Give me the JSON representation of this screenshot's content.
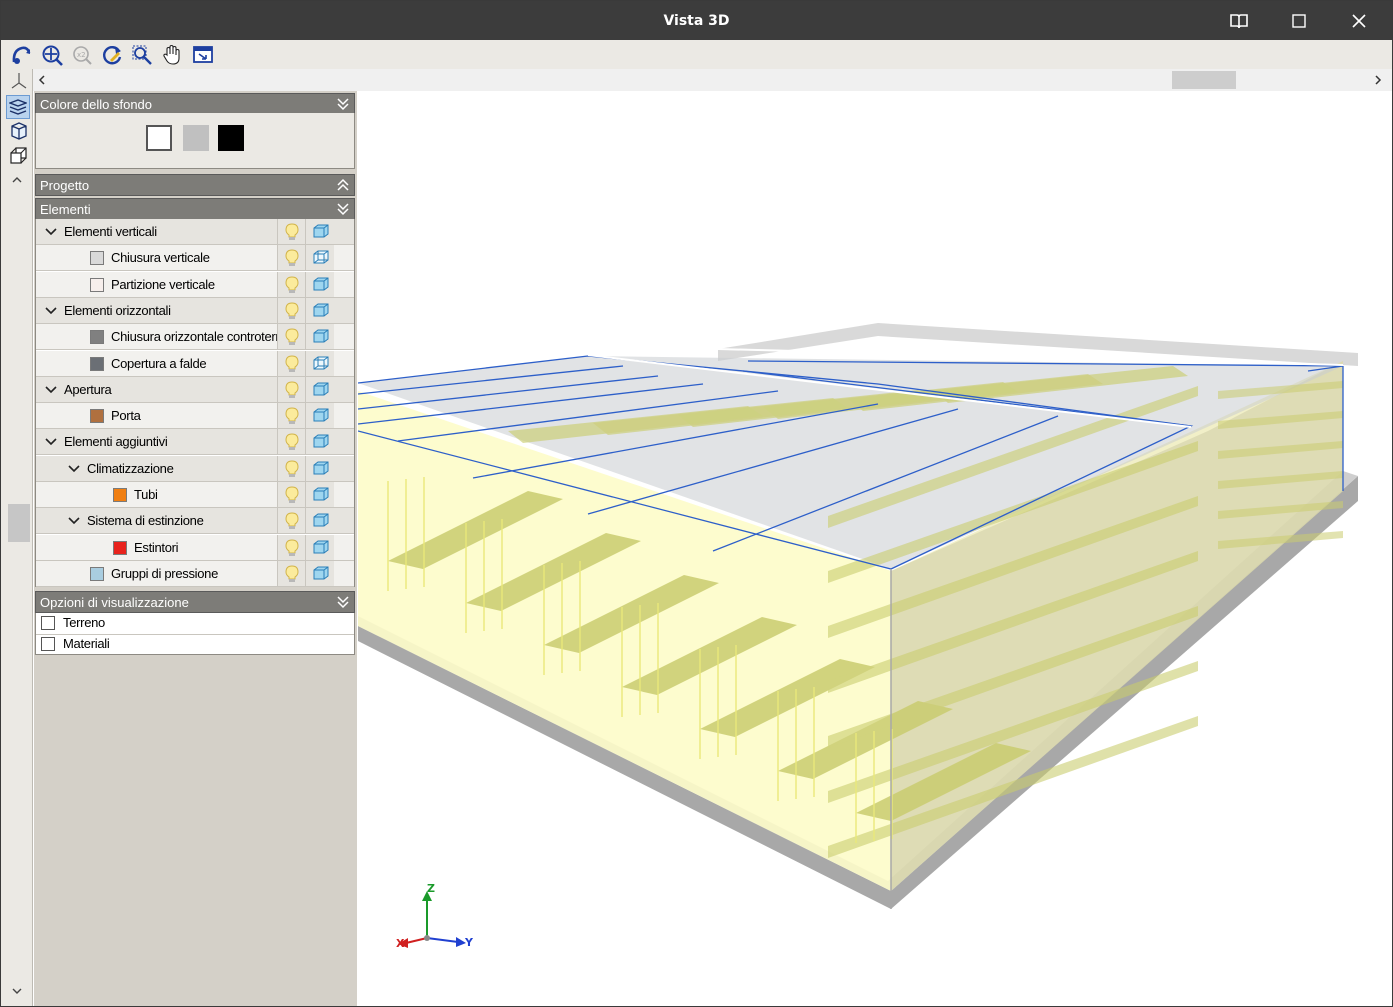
{
  "window": {
    "title": "Vista 3D"
  },
  "panel": {
    "background_section": {
      "title": "Colore dello sfondo",
      "swatches": [
        "#ffffff",
        "#c0c0c0",
        "#000000"
      ]
    },
    "project_section": {
      "title": "Progetto"
    },
    "elements_section": {
      "title": "Elementi",
      "items": [
        {
          "label": "Elementi verticali",
          "level": 0,
          "group": true
        },
        {
          "label": "Chiusura verticale",
          "level": 1,
          "color": "#d9d9d9",
          "visibility": "wire"
        },
        {
          "label": "Partizione verticale",
          "level": 1,
          "color": "#f7efec",
          "visibility": "solid"
        },
        {
          "label": "Elementi orizzontali",
          "level": 0,
          "group": true
        },
        {
          "label": "Chiusura orizzontale controterra",
          "level": 1,
          "color": "#808080",
          "visibility": "solid"
        },
        {
          "label": "Copertura a falde",
          "level": 1,
          "color": "#6b6f75",
          "visibility": "wire"
        },
        {
          "label": "Apertura",
          "level": 0,
          "group": true
        },
        {
          "label": "Porta",
          "level": 1,
          "color": "#b0703f",
          "visibility": "solid"
        },
        {
          "label": "Elementi aggiuntivi",
          "level": 0,
          "group": true
        },
        {
          "label": "Climatizzazione",
          "level": 1,
          "group": true
        },
        {
          "label": "Tubi",
          "level": 2,
          "color": "#f07f12",
          "visibility": "solid"
        },
        {
          "label": "Sistema di estinzione",
          "level": 1,
          "group": true
        },
        {
          "label": "Estintori",
          "level": 2,
          "color": "#e8221c",
          "visibility": "solid"
        },
        {
          "label": "Gruppi di pressione",
          "level": 1,
          "color": "#a9cde0",
          "visibility": "solid"
        }
      ]
    },
    "display_options": {
      "title": "Opzioni di visualizzazione",
      "options": [
        {
          "label": "Terreno",
          "checked": false
        },
        {
          "label": "Materiali",
          "checked": false
        }
      ]
    }
  },
  "axes": {
    "z": "Z",
    "x": "X",
    "y": "Y"
  },
  "colors": {
    "accent": "#1e5bd8",
    "shelf": "#c9cc6e",
    "wall": "#d9d9d9"
  }
}
